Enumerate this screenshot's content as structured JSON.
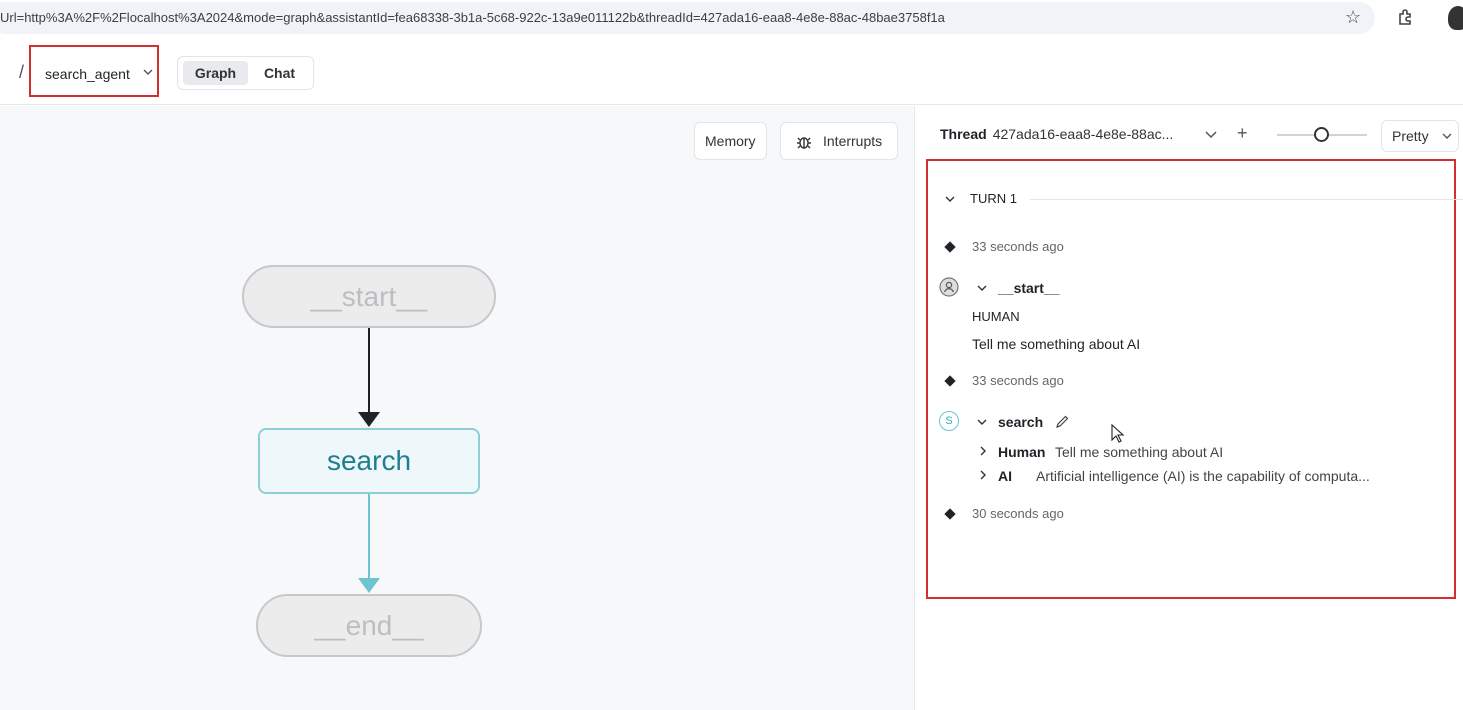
{
  "browser": {
    "url": "Url=http%3A%2F%2Flocalhost%3A2024&mode=graph&assistantId=fea68338-3b1a-5c68-922c-13a9e011122b&threadId=427ada16-eaa8-4e8e-88ac-48bae3758f1a"
  },
  "header": {
    "separator": "/",
    "agent_name": "search_agent",
    "modes": [
      "Graph",
      "Chat"
    ],
    "active_mode": "Graph"
  },
  "canvas": {
    "memory_label": "Memory",
    "interrupts_label": "Interrupts",
    "nodes": {
      "start": "__start__",
      "search": "search",
      "end": "__end__"
    }
  },
  "thread": {
    "label": "Thread",
    "id": "427ada16-eaa8-4e8e-88ac...",
    "view_mode": "Pretty",
    "turn_label": "TURN 1",
    "events": {
      "t1": "33 seconds ago",
      "start_node": "__start__",
      "human_role": "HUMAN",
      "human_message": "Tell me something about AI",
      "t2": "33 seconds ago",
      "search_node": "search",
      "search_avatar": "S",
      "msg_human_role": "Human",
      "msg_human_text": "Tell me something about AI",
      "msg_ai_role": "AI",
      "msg_ai_text": "Artificial intelligence (AI) is the capability of computa...",
      "t3": "30 seconds ago"
    }
  },
  "colors": {
    "highlight_red": "#d32f2f",
    "node_teal": "#1f7f8f",
    "edge_teal": "#6cc4d0"
  }
}
